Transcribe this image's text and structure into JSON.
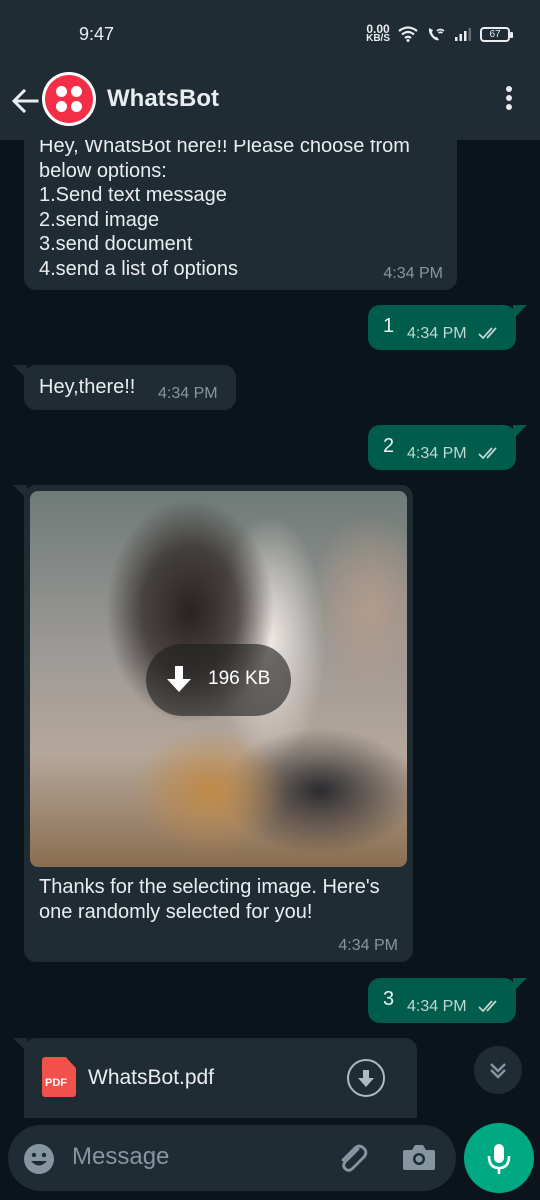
{
  "status_bar": {
    "time": "9:47",
    "net_speed_value": "0.00",
    "net_speed_unit": "KB/S",
    "battery": "67"
  },
  "header": {
    "title": "WhatsBot",
    "back_icon": "arrow-left-icon",
    "menu_icon": "more-vertical-icon"
  },
  "messages": [
    {
      "direction": "incoming",
      "lines": [
        "Hey, WhatsBot here!! Please choose from",
        "below options:",
        "1.Send text message",
        "2.send image",
        "3.send document",
        "4.send a list of options"
      ],
      "time": "4:34 PM"
    },
    {
      "direction": "outgoing",
      "text": "1",
      "time": "4:34 PM",
      "status": "read"
    },
    {
      "direction": "incoming",
      "text": "Hey,there!!",
      "time": "4:34 PM"
    },
    {
      "direction": "outgoing",
      "text": "2",
      "time": "4:34 PM",
      "status": "read"
    },
    {
      "direction": "incoming",
      "type": "image",
      "download_size": "196 KB",
      "caption_lines": [
        "Thanks for the selecting image. Here's",
        "one randomly selected for you!"
      ],
      "time": "4:34 PM"
    },
    {
      "direction": "outgoing",
      "text": "3",
      "time": "4:34 PM",
      "status": "read"
    },
    {
      "direction": "incoming",
      "type": "document",
      "file_badge": "PDF",
      "file_name": "WhatsBot.pdf"
    }
  ],
  "composer": {
    "placeholder": "Message",
    "icons": [
      "emoji-icon",
      "attach-icon",
      "camera-icon",
      "mic-icon"
    ]
  },
  "colors": {
    "chat_bg": "#0b141a",
    "bar_bg": "#1f2c34",
    "incoming_bubble": "#202c33",
    "outgoing_bubble": "#005c4b",
    "accent": "#00a884",
    "avatar_red": "#f22f46",
    "pdf_red": "#f0514a"
  }
}
